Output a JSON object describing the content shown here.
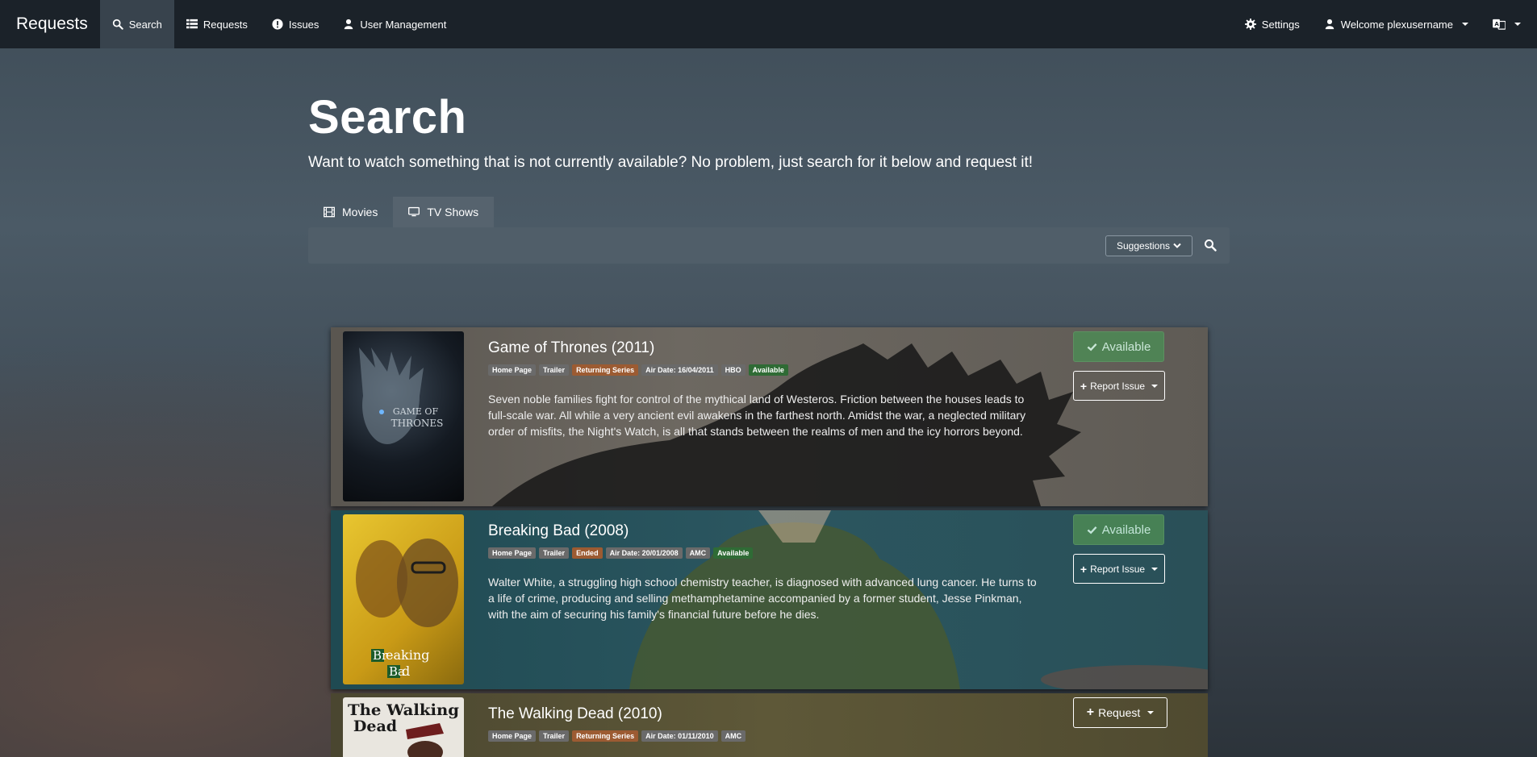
{
  "navbar": {
    "brand": "Requests",
    "items": [
      {
        "label": "Search",
        "icon": "search-icon"
      },
      {
        "label": "Requests",
        "icon": "list-icon"
      },
      {
        "label": "Issues",
        "icon": "exclamation-icon"
      },
      {
        "label": "User Management",
        "icon": "user-icon"
      }
    ],
    "settings_label": "Settings",
    "welcome_label": "Welcome plexusername",
    "language_icon": "language-icon"
  },
  "header": {
    "title": "Search",
    "subtitle": "Want to watch something that is not currently available? No problem, just search for it below and request it!"
  },
  "tabs": [
    {
      "label": "Movies",
      "icon": "film-icon"
    },
    {
      "label": "TV Shows",
      "icon": "monitor-icon",
      "active": true
    }
  ],
  "search": {
    "value": "",
    "suggestions_label": "Suggestions"
  },
  "results": [
    {
      "title": "Game of Thrones (2011)",
      "labels": [
        "Home Page",
        "Trailer",
        "Returning Series",
        "Air Date: 16/04/2011",
        "HBO",
        "Available"
      ],
      "overview": "Seven noble families fight for control of the mythical land of Westeros. Friction between the houses leads to full-scale war. All while a very ancient evil awakens in the farthest north. Amidst the war, a neglected military order of misfits, the Night's Watch, is all that stands between the realms of men and the icy horrors beyond.",
      "available_label": "Available",
      "report_label": "Report Issue",
      "poster_text": "GAME OF THRONES"
    },
    {
      "title": "Breaking Bad (2008)",
      "labels": [
        "Home Page",
        "Trailer",
        "Ended",
        "Air Date: 20/01/2008",
        "AMC",
        "Available"
      ],
      "overview": "Walter White, a struggling high school chemistry teacher, is diagnosed with advanced lung cancer. He turns to a life of crime, producing and selling methamphetamine accompanied by a former student, Jesse Pinkman, with the aim of securing his family's financial future before he dies.",
      "available_label": "Available",
      "report_label": "Report Issue",
      "poster_text_1": "Br",
      "poster_text_2": "eaking",
      "poster_text_3": "Ba",
      "poster_text_4": "d"
    },
    {
      "title": "The Walking Dead (2010)",
      "labels": [
        "Home Page",
        "Trailer",
        "Returning Series",
        "Air Date: 01/11/2010",
        "AMC"
      ],
      "request_label": "Request",
      "poster_text": "The Walking Dead"
    }
  ],
  "colors": {
    "navbar": "#1b2229",
    "available_green": "#4d8a55",
    "label_orange": "#9c5b32",
    "label_green": "#2f6b35"
  }
}
